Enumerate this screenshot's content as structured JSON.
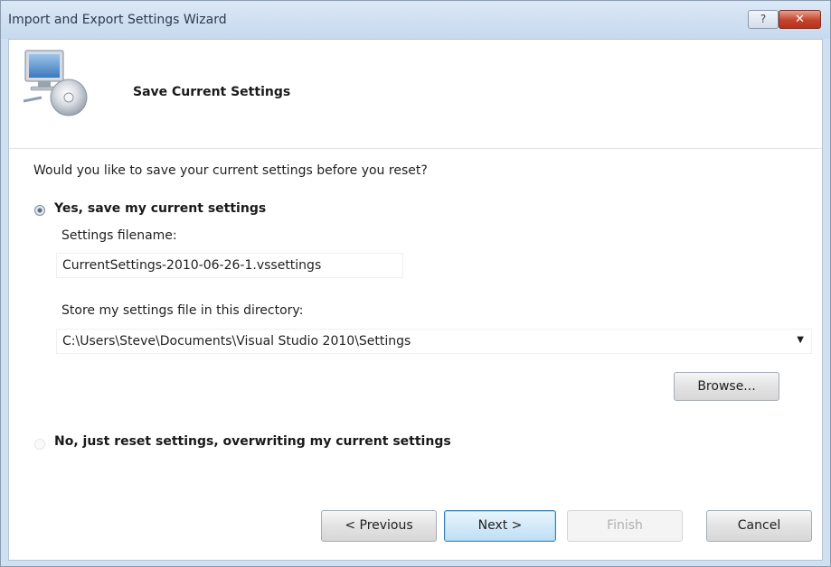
{
  "window": {
    "title": "Import and Export Settings Wizard",
    "help_label": "?",
    "close_label": "✕"
  },
  "header": {
    "title": "Save Current Settings",
    "icon": "computer-disc-icon"
  },
  "content": {
    "question": "Would you like to save your current settings before you reset?",
    "option_yes": {
      "label": "Yes, save my current settings",
      "selected": true
    },
    "filename_label": "Settings filename:",
    "filename_value": "CurrentSettings-2010-06-26-1.vssettings",
    "directory_label": "Store my settings file in this directory:",
    "directory_value": "C:\\Users\\Steve\\Documents\\Visual Studio 2010\\Settings",
    "browse_label": "Browse...",
    "option_no": {
      "label": "No, just reset settings, overwriting my current settings",
      "selected": false
    }
  },
  "footer": {
    "previous_label": "< Previous",
    "next_label": "Next >",
    "finish_label": "Finish",
    "cancel_label": "Cancel"
  }
}
